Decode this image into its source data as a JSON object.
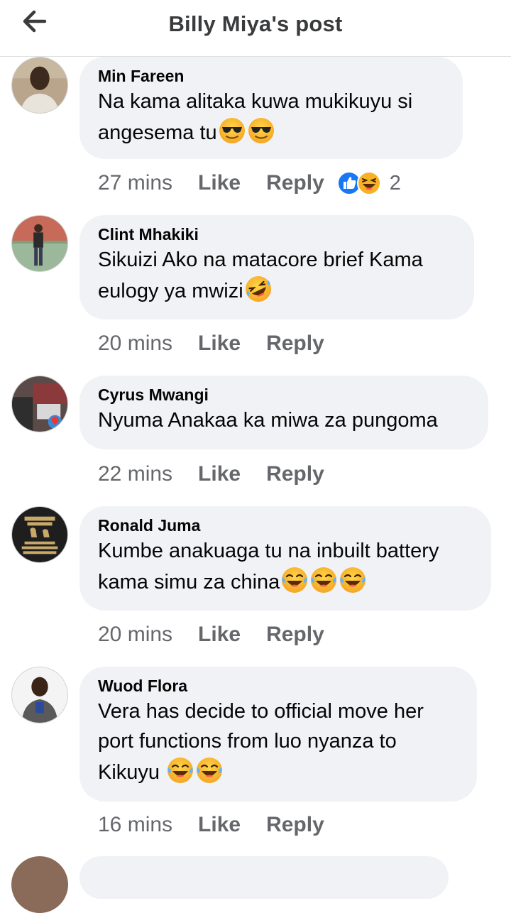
{
  "header": {
    "title": "Billy Miya's post",
    "back_icon": "arrow-left-icon"
  },
  "colors": {
    "bubble": "#f0f2f5",
    "meta": "#65676b",
    "like_blue": "#1877f2",
    "haha_yellow": "#f7b125"
  },
  "comments": [
    {
      "author": "Min Fareen",
      "text": "Na kama alitaka kuwa mukikuyu si angesema tu",
      "emojis": [
        "sunglasses-emoji",
        "sunglasses-emoji"
      ],
      "time": "27 mins",
      "like_label": "Like",
      "reply_label": "Reply",
      "reactions": [
        "like-reaction-icon",
        "haha-reaction-icon"
      ],
      "reaction_count": "2"
    },
    {
      "author": "Clint Mhakiki",
      "text": "Sikuizi Ako na matacore brief Kama eulogy ya mwizi",
      "emojis": [
        "rofl-emoji"
      ],
      "time": "20 mins",
      "like_label": "Like",
      "reply_label": "Reply"
    },
    {
      "author": "Cyrus Mwangi",
      "text": "Nyuma Anakaa ka miwa za pungoma",
      "emojis": [],
      "time": "22 mins",
      "like_label": "Like",
      "reply_label": "Reply"
    },
    {
      "author": "Ronald Juma",
      "text": "Kumbe anakuaga tu na inbuilt battery kama simu za china",
      "emojis": [
        "tears-of-joy-emoji",
        "tears-of-joy-emoji",
        "tears-of-joy-emoji"
      ],
      "time": "20 mins",
      "like_label": "Like",
      "reply_label": "Reply"
    },
    {
      "author": "Wuod Flora",
      "text": "Vera has decide to official move her port functions from luo nyanza to Kikuyu",
      "emojis": [
        "tears-of-joy-emoji",
        "tears-of-joy-emoji"
      ],
      "time": "16 mins",
      "like_label": "Like",
      "reply_label": "Reply"
    }
  ]
}
